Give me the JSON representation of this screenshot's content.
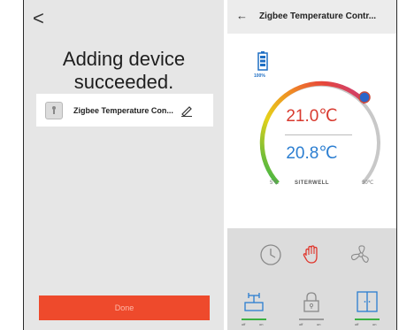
{
  "left_screen": {
    "back_glyph": "<",
    "title": "Adding device succeeded.",
    "device_name": "Zigbee Temperature Con...",
    "done_label": "Done"
  },
  "right_screen": {
    "header_title": "Zigbee Temperature Contr...",
    "battery_level": "100%",
    "set_temperature": "21.0℃",
    "current_temperature": "20.8℃",
    "range_min": "5℃",
    "range_max": "30℃",
    "brand": "SITERWELL",
    "controls": [
      {
        "icon": "clock-icon",
        "off_label": "",
        "on_label": ""
      },
      {
        "icon": "hand-icon",
        "off_label": "",
        "on_label": ""
      },
      {
        "icon": "fan-icon",
        "off_label": "",
        "on_label": ""
      },
      {
        "icon": "valve-icon",
        "off_label": "off",
        "on_label": "on"
      },
      {
        "icon": "lock-icon",
        "off_label": "off",
        "on_label": "on"
      },
      {
        "icon": "window-icon",
        "off_label": "off",
        "on_label": "on"
      }
    ]
  },
  "colors": {
    "accent_red": "#ee4a2c",
    "temp_set": "#d83a2f",
    "temp_current": "#2b7ed1",
    "toggle_green": "#3cb043"
  }
}
